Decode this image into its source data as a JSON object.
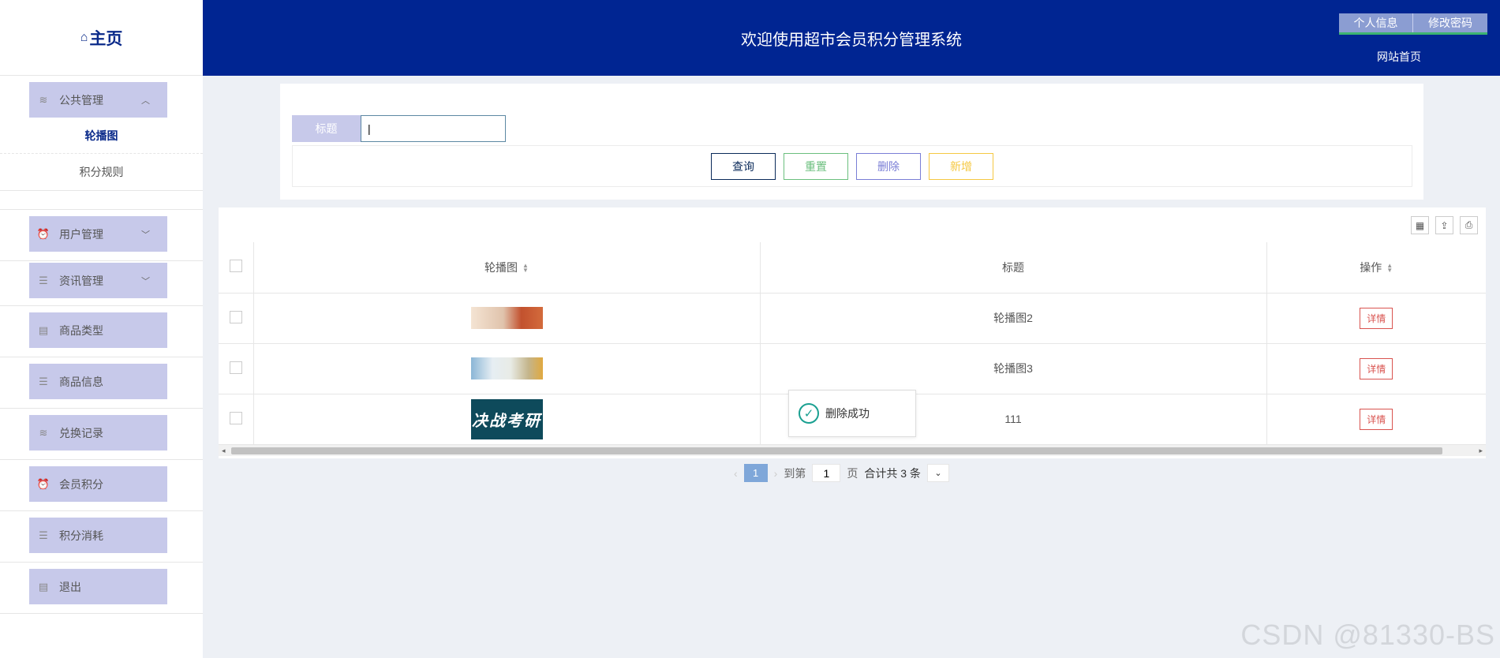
{
  "sidebar": {
    "logo_icon": "⌂",
    "logo_label": "主页",
    "groups": [
      {
        "icon": "layers-icon",
        "label": "公共管理",
        "expanded": true
      },
      {
        "icon": "alarm-icon",
        "label": "用户管理",
        "expanded": false
      },
      {
        "icon": "list-icon",
        "label": "资讯管理",
        "expanded": false
      },
      {
        "icon": "clipboard-icon",
        "label": "商品类型"
      },
      {
        "icon": "list-icon",
        "label": "商品信息"
      },
      {
        "icon": "layers-icon",
        "label": "兑换记录"
      },
      {
        "icon": "alarm-icon",
        "label": "会员积分"
      },
      {
        "icon": "list-icon",
        "label": "积分消耗"
      },
      {
        "icon": "clipboard-icon",
        "label": "退出"
      }
    ],
    "submenu": [
      {
        "label": "轮播图",
        "active": true
      },
      {
        "label": "积分规则",
        "active": false
      }
    ]
  },
  "header": {
    "title": "欢迎使用超市会员积分管理系统",
    "profile_button": "个人信息",
    "password_button": "修改密码",
    "home_link": "网站首页"
  },
  "search": {
    "label": "标题",
    "value": "|",
    "buttons": {
      "query": "查询",
      "reset": "重置",
      "delete": "删除",
      "add": "新增"
    }
  },
  "table": {
    "columns": {
      "image": "轮播图",
      "title": "标题",
      "action": "操作"
    },
    "rows": [
      {
        "title": "轮播图2",
        "action": "详情"
      },
      {
        "title": "轮播图3",
        "action": "详情"
      },
      {
        "title": "111",
        "action": "详情",
        "image_text": "决战考研"
      }
    ]
  },
  "pagination": {
    "current_page": "1",
    "goto_prefix": "到第",
    "goto_value": "1",
    "goto_suffix": "页",
    "total": "合计共 3 条"
  },
  "toast": {
    "message": "删除成功"
  },
  "watermark": "CSDN @81330-BS",
  "colors": {
    "header_bg": "#002592",
    "menu_bg": "#c7c9ea",
    "accent_danger": "#d9534f",
    "page_active": "#7fa7d9"
  }
}
